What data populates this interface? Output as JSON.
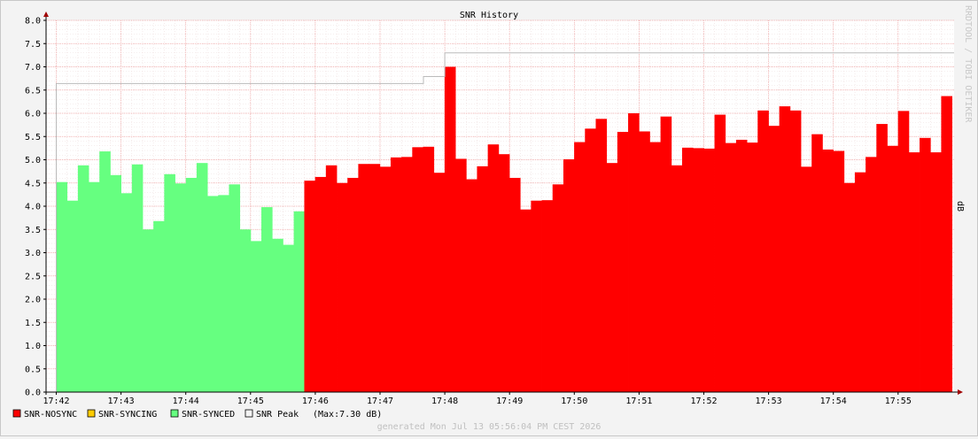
{
  "chart_data": {
    "type": "area",
    "title": "SNR History",
    "ylabel": "dB",
    "side_label": "RRDTOOL / TOBI OETIKER",
    "ylim": [
      0,
      8.0
    ],
    "y_ticks": [
      "0.0",
      "0.5",
      "1.0",
      "1.5",
      "2.0",
      "2.5",
      "3.0",
      "3.5",
      "4.0",
      "4.5",
      "5.0",
      "5.5",
      "6.0",
      "6.5",
      "7.0",
      "7.5",
      "8.0"
    ],
    "x_ticks": [
      "17:42",
      "17:43",
      "17:44",
      "17:45",
      "17:46",
      "17:47",
      "17:48",
      "17:49",
      "17:50",
      "17:51",
      "17:52",
      "17:53",
      "17:54",
      "17:55"
    ],
    "x_range_minutes": [
      0,
      13.83
    ],
    "series": [
      {
        "name": "SNR-SYNCED",
        "color": "#66ff80",
        "start_minute": 0,
        "step_minutes": 0.1667,
        "values": [
          4.52,
          4.12,
          4.88,
          4.52,
          5.18,
          4.67,
          4.28,
          4.9,
          3.5,
          3.68,
          4.69,
          4.49,
          4.61,
          4.93,
          4.22,
          4.24,
          4.47,
          3.5,
          3.25,
          3.98,
          3.3,
          3.17,
          3.89
        ]
      },
      {
        "name": "SNR-NOSYNC",
        "color": "#ff0000",
        "start_minute": 3.83,
        "step_minutes": 0.1667,
        "values": [
          4.55,
          4.63,
          4.88,
          4.5,
          4.61,
          4.91,
          4.91,
          4.85,
          5.05,
          5.06,
          5.27,
          5.28,
          4.72,
          7.0,
          5.02,
          4.58,
          4.86,
          5.33,
          5.12,
          4.61,
          3.93,
          4.12,
          4.13,
          4.47,
          5.01,
          5.38,
          5.67,
          5.88,
          4.93,
          5.6,
          6.0,
          5.61,
          5.38,
          5.93,
          4.88,
          5.26,
          5.25,
          5.24,
          5.97,
          5.36,
          5.43,
          5.37,
          6.06,
          5.73,
          6.15,
          6.06,
          4.85,
          5.55,
          5.22,
          5.19,
          4.5,
          4.73,
          5.06,
          5.77,
          5.3,
          6.05,
          5.16,
          5.47,
          5.16,
          6.37
        ]
      }
    ],
    "peak_series": {
      "name": "SNR Peak",
      "color": "#bbbbbb",
      "steps": [
        {
          "from_minute": 0,
          "value": 6.64
        },
        {
          "from_minute": 5.67,
          "value": 6.79
        },
        {
          "from_minute": 6.0,
          "value": 7.3
        }
      ]
    },
    "grid": true
  },
  "legend": {
    "items": [
      {
        "label": "SNR-NOSYNC",
        "color": "#ff0000"
      },
      {
        "label": "SNR-SYNCING",
        "color": "#ffcc00"
      },
      {
        "label": "SNR-SYNCED",
        "color": "#66ff80"
      },
      {
        "label": "SNR Peak",
        "color": "#f3f3f3"
      }
    ],
    "peak_note": "(Max:7.30 dB)"
  },
  "footer": "generated Mon Jul 13 05:56:04 PM CEST 2026"
}
